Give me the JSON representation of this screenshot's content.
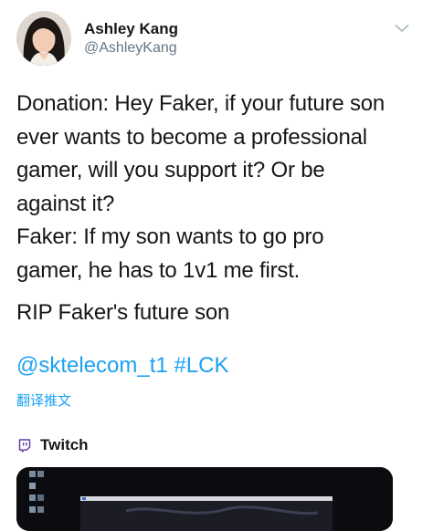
{
  "author": {
    "display_name": "Ashley Kang",
    "handle": "@AshleyKang"
  },
  "tweet": {
    "paragraph_1": [
      "Donation: Hey Faker, if your future son",
      "ever wants to become a professional",
      "gamer, will you support it? Or be",
      "against it?",
      "Faker: If my son wants to go pro",
      "gamer, he has to 1v1 me first."
    ],
    "paragraph_2": "RIP Faker's future son",
    "mention": "@sktelecom_t1",
    "hashtag": "#LCK",
    "translate_label": "翻译推文"
  },
  "source": {
    "label": "Twitch",
    "icon": "twitch-icon"
  },
  "colors": {
    "link": "#1da1f2",
    "text": "#14171a",
    "secondary": "#657786",
    "twitch": "#6441a5"
  }
}
